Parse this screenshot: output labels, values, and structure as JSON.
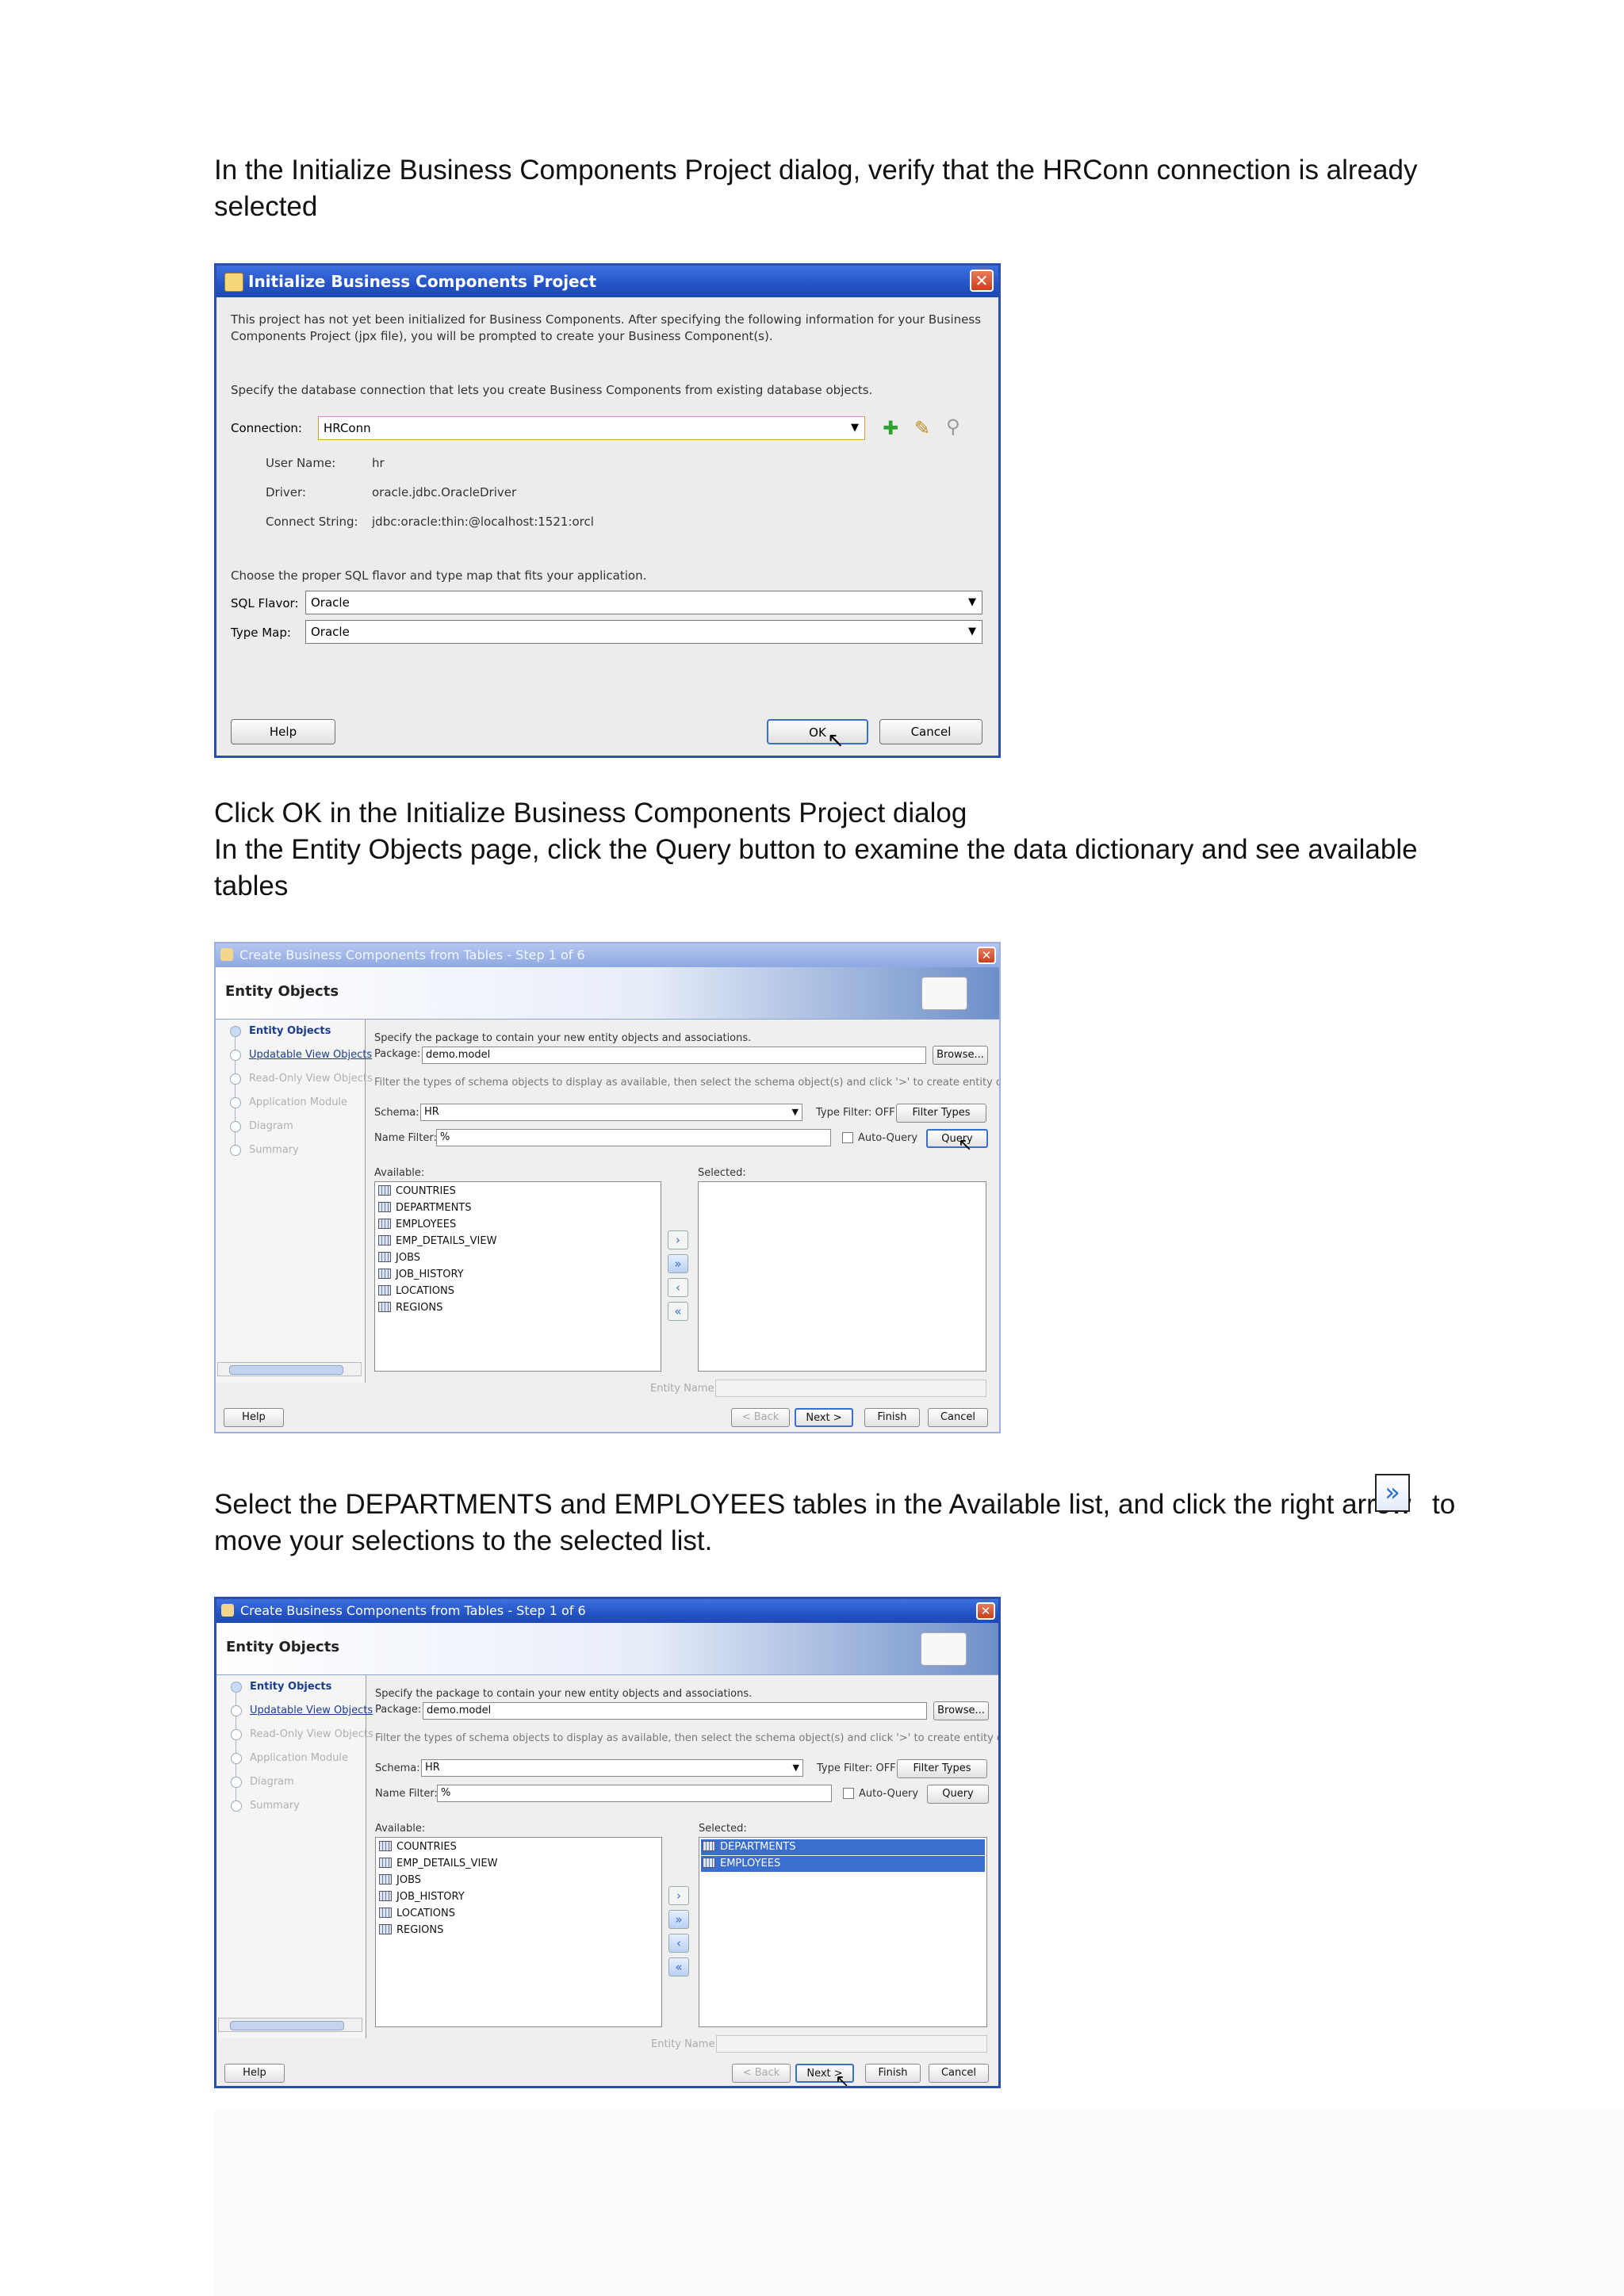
{
  "paragraphs": {
    "p1": "In the Initialize Business Components Project dialog, verify that the HRConn connection is already selected",
    "p2_line1": "Click OK in the Initialize Business Components Project dialog",
    "p2_line2": "In the Entity Objects page, click the Query button to examine the data dictionary and see available tables",
    "p3_before": "Select the DEPARTMENTS and EMPLOYEES tables in the Available list, and click the right arrow",
    "p3_after": "to",
    "p3_line2": "move your selections to the selected list."
  },
  "dialog1": {
    "title": "Initialize Business Components Project",
    "intro": "This project has not yet been initialized for Business Components.  After specifying the following information for your Business Components Project (jpx file), you will be prompted to create your Business Component(s).",
    "spec": "Specify the database connection that lets you create Business Components from existing database objects.",
    "connection_label": "Connection:",
    "connection_value": "HRConn",
    "user_label": "User Name:",
    "user_value": "hr",
    "driver_label": "Driver:",
    "driver_value": "oracle.jdbc.OracleDriver",
    "connect_label": "Connect String:",
    "connect_value": "jdbc:oracle:thin:@localhost:1521:orcl",
    "sql_note": "Choose the proper SQL flavor and type map that fits your application.",
    "sql_label": "SQL Flavor:",
    "sql_value": "Oracle",
    "typemap_label": "Type Map:",
    "typemap_value": "Oracle",
    "help": "Help",
    "ok": "OK",
    "cancel": "Cancel"
  },
  "wizard": {
    "title": "Create Business Components from Tables - Step 1 of 6",
    "banner": "Entity Objects",
    "nav": [
      "Entity Objects",
      "Updatable View Objects",
      "Read-Only View Objects",
      "Application Module",
      "Diagram",
      "Summary"
    ],
    "package_note": "Specify the package to contain your new entity objects and associations.",
    "package_label": "Package:",
    "package_value": "demo.model",
    "browse": "Browse...",
    "filter_note": "Filter the types of schema objects to display as available, then select the schema object(s) and click '>' to create entity objects.",
    "schema_label": "Schema:",
    "schema_value": "HR",
    "type_filter": "Type Filter: OFF",
    "filter_types": "Filter Types",
    "name_filter_label": "Name Filter:",
    "name_filter_value": "%",
    "auto_query": "Auto-Query",
    "query": "Query",
    "available_label": "Available:",
    "selected_label": "Selected:",
    "entity_name_label": "Entity Name:",
    "help": "Help",
    "back": "< Back",
    "next": "Next >",
    "finish": "Finish",
    "cancel": "Cancel"
  },
  "shot2_available": [
    "COUNTRIES",
    "DEPARTMENTS",
    "EMPLOYEES",
    "EMP_DETAILS_VIEW",
    "JOBS",
    "JOB_HISTORY",
    "LOCATIONS",
    "REGIONS"
  ],
  "shot3_available": [
    "COUNTRIES",
    "EMP_DETAILS_VIEW",
    "JOBS",
    "JOB_HISTORY",
    "LOCATIONS",
    "REGIONS"
  ],
  "shot3_selected": [
    "DEPARTMENTS",
    "EMPLOYEES"
  ],
  "icons": {
    "add": "plus-icon",
    "edit": "pencil-icon",
    "browse": "magnifier-icon",
    "move_right": "right-arrow-icon"
  }
}
